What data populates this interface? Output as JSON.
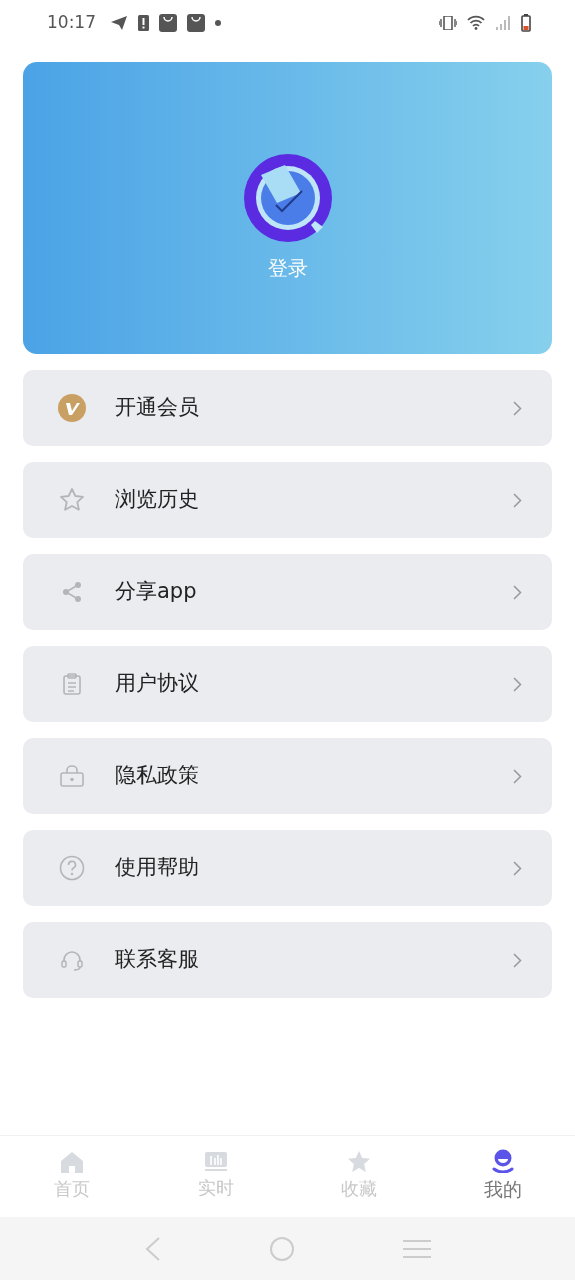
{
  "status_bar": {
    "time": "10:17"
  },
  "profile": {
    "login_label": "登录"
  },
  "menu": [
    {
      "label": "开通会员"
    },
    {
      "label": "浏览历史"
    },
    {
      "label": "分享app"
    },
    {
      "label": "用户协议"
    },
    {
      "label": "隐私政策"
    },
    {
      "label": "使用帮助"
    },
    {
      "label": "联系客服"
    }
  ],
  "tab_bar": [
    {
      "label": "首页",
      "selected": false
    },
    {
      "label": "实时",
      "selected": false
    },
    {
      "label": "收藏",
      "selected": false
    },
    {
      "label": "我的",
      "selected": true
    }
  ]
}
